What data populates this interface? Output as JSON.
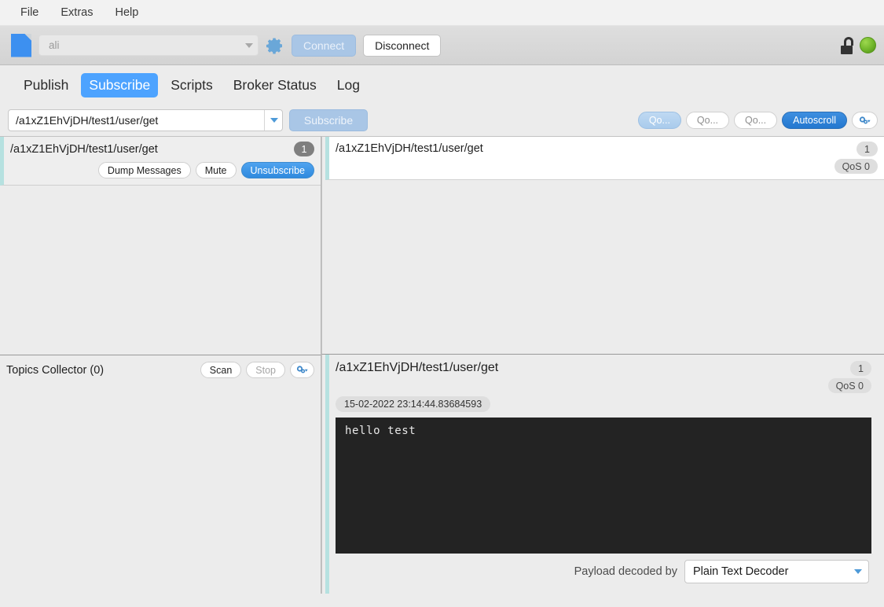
{
  "menu": {
    "items": [
      {
        "label": "File"
      },
      {
        "label": "Extras"
      },
      {
        "label": "Help"
      }
    ]
  },
  "toolbar": {
    "file_icon": "file-icon",
    "profile": {
      "value": "ali",
      "placeholder": "ali"
    },
    "settings_icon": "gear-icon",
    "connect_label": "Connect",
    "disconnect_label": "Disconnect",
    "lock_icon": "unlocked-padlock-icon",
    "status_indicator": "connected-green-dot",
    "accent_blue": "#4da3ff",
    "status_green": "#74b82c"
  },
  "tabs": [
    {
      "label": "Publish",
      "active": false
    },
    {
      "label": "Subscribe",
      "active": true
    },
    {
      "label": "Scripts",
      "active": false
    },
    {
      "label": "Broker Status",
      "active": false
    },
    {
      "label": "Log",
      "active": false
    }
  ],
  "subscribe_bar": {
    "topic_value": "/a1xZ1EhVjDH/test1/user/get",
    "subscribe_label": "Subscribe",
    "qos_buttons": [
      {
        "label": "Qo...",
        "selected": true
      },
      {
        "label": "Qo...",
        "selected": false
      },
      {
        "label": "Qo...",
        "selected": false
      }
    ],
    "autoscroll_label": "Autoscroll",
    "autoscroll_on": true,
    "options_icon": "gear-dropdown-icon"
  },
  "subscriptions": {
    "items": [
      {
        "topic": "/a1xZ1EhVjDH/test1/user/get",
        "count": "1",
        "dump_label": "Dump Messages",
        "mute_label": "Mute",
        "unsubscribe_label": "Unsubscribe"
      }
    ]
  },
  "topics_collector": {
    "title": "Topics Collector (0)",
    "scan_label": "Scan",
    "stop_label": "Stop",
    "options_icon": "gear-dropdown-icon"
  },
  "messages": {
    "items": [
      {
        "topic": "/a1xZ1EhVjDH/test1/user/get",
        "index": "1",
        "qos": "QoS 0"
      }
    ]
  },
  "message_detail": {
    "topic": "/a1xZ1EhVjDH/test1/user/get",
    "index": "1",
    "qos": "QoS 0",
    "timestamp": "15-02-2022  23:14:44.83684593",
    "payload": "hello test",
    "decoder_label": "Payload decoded by",
    "decoder_value": "Plain Text Decoder"
  }
}
